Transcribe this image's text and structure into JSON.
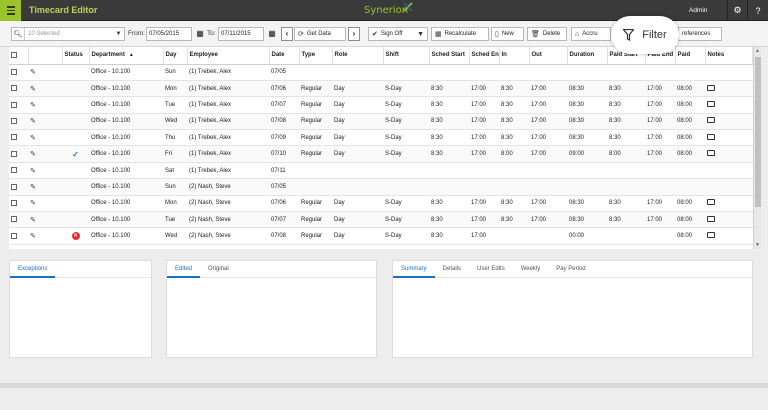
{
  "app": {
    "title": "Timecard Editor",
    "logo": "Synerion",
    "user": "Admin"
  },
  "toolbar": {
    "select_placeholder": "10 Selected",
    "from_label": "From:",
    "from_date": "07/05/2015",
    "to_label": "To:",
    "to_date": "07/11/2015",
    "get_data": "Get Data",
    "sign_off": "Sign Off",
    "recalculate": "Recalculate",
    "new": "New",
    "delete": "Delete",
    "accruals": "Accru",
    "filter": "Filter",
    "preferences": "references"
  },
  "grid": {
    "headers": [
      "Status",
      "Department",
      "Day",
      "Employee",
      "Date",
      "Type",
      "Role",
      "Shift",
      "Sched Start",
      "Sched End",
      "In",
      "Out",
      "Duration",
      "Paid Start",
      "Paid End",
      "Paid",
      "Notes"
    ],
    "sort_column": "Department",
    "rows": [
      {
        "status": "",
        "dept": "Office - 10.100",
        "day": "Sun",
        "emp": "(1) Trebek, Alex",
        "date": "07/05",
        "type": "",
        "role": "",
        "shift": "",
        "ss": "",
        "se": "",
        "in": "",
        "out": "",
        "dur": "",
        "ps": "",
        "pe": "",
        "paid": "",
        "note": false
      },
      {
        "status": "",
        "dept": "Office - 10.100",
        "day": "Mon",
        "emp": "(1) Trebek, Alex",
        "date": "07/06",
        "type": "Regular",
        "role": "Day",
        "shift": "S-Day",
        "ss": "8:30",
        "se": "17:00",
        "in": "8:30",
        "out": "17:00",
        "dur": "08:30",
        "ps": "8:30",
        "pe": "17:00",
        "paid": "08:00",
        "note": true
      },
      {
        "status": "",
        "dept": "Office - 10.100",
        "day": "Tue",
        "emp": "(1) Trebek, Alex",
        "date": "07/07",
        "type": "Regular",
        "role": "Day",
        "shift": "S-Day",
        "ss": "8:30",
        "se": "17:00",
        "in": "8:30",
        "out": "17:00",
        "dur": "08:30",
        "ps": "8:30",
        "pe": "17:00",
        "paid": "08:00",
        "note": true
      },
      {
        "status": "",
        "dept": "Office - 10.100",
        "day": "Wed",
        "emp": "(1) Trebek, Alex",
        "date": "07/08",
        "type": "Regular",
        "role": "Day",
        "shift": "S-Day",
        "ss": "8:30",
        "se": "17:00",
        "in": "8:30",
        "out": "17:00",
        "dur": "08:30",
        "ps": "8:30",
        "pe": "17:00",
        "paid": "08:00",
        "note": true
      },
      {
        "status": "",
        "dept": "Office - 10.100",
        "day": "Thu",
        "emp": "(1) Trebek, Alex",
        "date": "07/09",
        "type": "Regular",
        "role": "Day",
        "shift": "S-Day",
        "ss": "8:30",
        "se": "17:00",
        "in": "8:30",
        "out": "17:00",
        "dur": "08:30",
        "ps": "8:30",
        "pe": "17:00",
        "paid": "08:00",
        "note": true
      },
      {
        "status": "check",
        "dept": "Office - 10.100",
        "day": "Fri",
        "emp": "(1) Trebek, Alex",
        "date": "07/10",
        "type": "Regular",
        "role": "Day",
        "shift": "S-Day",
        "ss": "8:30",
        "se": "17:00",
        "in": "8:00",
        "out": "17:00",
        "dur": "09:00",
        "ps": "8:00",
        "pe": "17:00",
        "paid": "08:00",
        "note": true
      },
      {
        "status": "",
        "dept": "Office - 10.100",
        "day": "Sat",
        "emp": "(1) Trebek, Alex",
        "date": "07/11",
        "type": "",
        "role": "",
        "shift": "",
        "ss": "",
        "se": "",
        "in": "",
        "out": "",
        "dur": "",
        "ps": "",
        "pe": "",
        "paid": "",
        "note": false
      },
      {
        "status": "",
        "dept": "Office - 10.100",
        "day": "Sun",
        "emp": "(2) Nash, Steve",
        "date": "07/05",
        "type": "",
        "role": "",
        "shift": "",
        "ss": "",
        "se": "",
        "in": "",
        "out": "",
        "dur": "",
        "ps": "",
        "pe": "",
        "paid": "",
        "note": false
      },
      {
        "status": "",
        "dept": "Office - 10.100",
        "day": "Mon",
        "emp": "(2) Nash, Steve",
        "date": "07/06",
        "type": "Regular",
        "role": "Day",
        "shift": "S-Day",
        "ss": "8:30",
        "se": "17:00",
        "in": "8:30",
        "out": "17:00",
        "dur": "08:30",
        "ps": "8:30",
        "pe": "17:00",
        "paid": "08:00",
        "note": true
      },
      {
        "status": "",
        "dept": "Office - 10.100",
        "day": "Tue",
        "emp": "(2) Nash, Steve",
        "date": "07/07",
        "type": "Regular",
        "role": "Day",
        "shift": "S-Day",
        "ss": "8:30",
        "se": "17:00",
        "in": "8:30",
        "out": "17:00",
        "dur": "08:30",
        "ps": "8:30",
        "pe": "17:00",
        "paid": "08:00",
        "note": true
      },
      {
        "status": "error",
        "dept": "Office - 10.100",
        "day": "Wed",
        "emp": "(2) Nash, Steve",
        "date": "07/08",
        "type": "Regular",
        "role": "Day",
        "shift": "S-Day",
        "ss": "8:30",
        "se": "17:00",
        "in": "",
        "out": "",
        "dur": "00:00",
        "ps": "",
        "pe": "",
        "paid": "08:00",
        "note": true
      }
    ]
  },
  "panels": {
    "left_tabs": [
      "Exceptions"
    ],
    "middle_tabs": [
      "Edited",
      "Original"
    ],
    "right_tabs": [
      "Summary",
      "Details",
      "User Edits",
      "Weekly",
      "Pay Period"
    ]
  },
  "colors": {
    "accent": "#9cc42a",
    "topbar": "#3a3a3a",
    "tab_active": "#1a6fc3",
    "approved": "#1a7bd1",
    "error": "#d33333"
  }
}
